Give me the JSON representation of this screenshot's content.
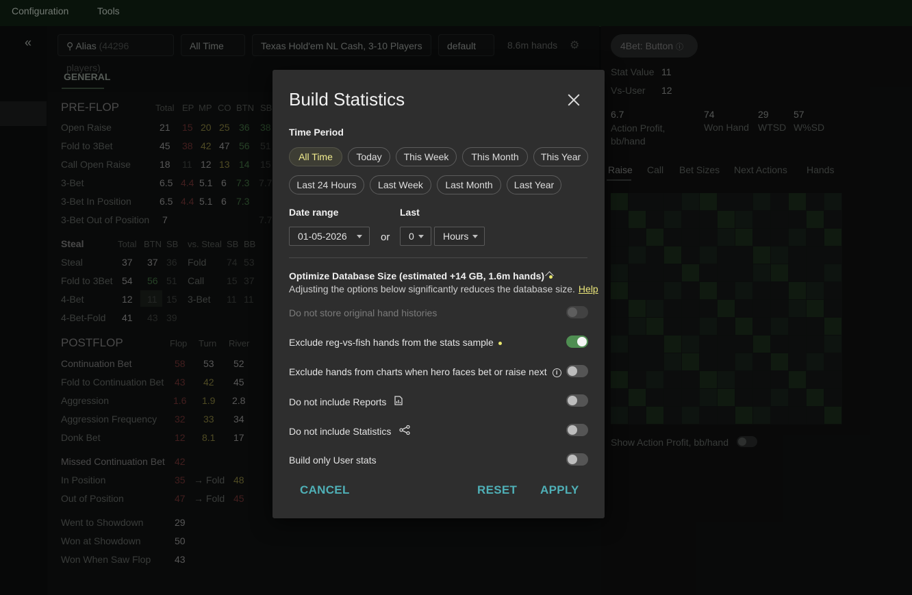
{
  "menubar": {
    "configuration": "Configuration",
    "tools": "Tools"
  },
  "filters": {
    "alias_label": "Alias",
    "alias_count": "(44296 players)",
    "period": "All Time",
    "game": "Texas Hold'em NL Cash, 3-10 Players",
    "preset": "default",
    "hands": "8.6m hands"
  },
  "tabs": {
    "general": "GENERAL"
  },
  "preflop": {
    "title": "PRE-FLOP",
    "cols": [
      "Total",
      "EP",
      "MP",
      "CO",
      "BTN",
      "SB"
    ],
    "rows": [
      {
        "label": "Open Raise",
        "values": [
          "21",
          "15",
          "20",
          "25",
          "36",
          "38"
        ]
      },
      {
        "label": "Fold to 3Bet",
        "values": [
          "45",
          "38",
          "42",
          "47",
          "56",
          "51"
        ]
      },
      {
        "label": "Call Open Raise",
        "values": [
          "18",
          "11",
          "12",
          "13",
          "14",
          "15"
        ]
      },
      {
        "label": "3-Bet",
        "values": [
          "6.5",
          "4.4",
          "5.1",
          "6",
          "7.3",
          "7.7"
        ]
      },
      {
        "label": "3-Bet In Position",
        "values": [
          "6.5",
          "4.4",
          "5.1",
          "6",
          "7.3",
          ""
        ]
      },
      {
        "label": "3-Bet Out of Position",
        "values": [
          "7",
          "",
          "",
          "",
          "",
          "7.7"
        ]
      }
    ]
  },
  "steal": {
    "title": "Steal",
    "cols": [
      "Total",
      "BTN",
      "SB",
      "vs. Steal",
      "SB",
      "BB"
    ],
    "rows": [
      {
        "label": "Steal",
        "values": [
          "37",
          "37",
          "36",
          "Fold",
          "74",
          "53"
        ]
      },
      {
        "label": "Fold to 3Bet",
        "values": [
          "54",
          "56",
          "51",
          "Call",
          "15",
          "37"
        ]
      },
      {
        "label": "4-Bet",
        "values": [
          "12",
          "11",
          "15",
          "3-Bet",
          "11",
          "11"
        ]
      },
      {
        "label": "4-Bet-Fold",
        "values": [
          "41",
          "43",
          "39",
          "",
          "",
          ""
        ]
      }
    ]
  },
  "postflop": {
    "title": "POSTFLOP",
    "cols": [
      "Flop",
      "Turn",
      "River"
    ],
    "rows": [
      {
        "label": "Continuation Bet",
        "values": [
          "58",
          "53",
          "52"
        ]
      },
      {
        "label": "Fold to Continuation Bet",
        "values": [
          "43",
          "42",
          "45"
        ]
      },
      {
        "label": "Aggression",
        "values": [
          "1.6",
          "1.9",
          "2.8"
        ]
      },
      {
        "label": "Aggression Frequency",
        "values": [
          "32",
          "33",
          "34"
        ]
      },
      {
        "label": "Donk Bet",
        "values": [
          "12",
          "8.1",
          "17"
        ]
      }
    ],
    "missed_title": "Missed Continuation Bet",
    "missed_value": "42",
    "missed_rows": [
      {
        "label": "In Position",
        "v1": "35",
        "arrow": "→ Fold",
        "v2": "48"
      },
      {
        "label": "Out of Position",
        "v1": "47",
        "arrow": "→ Fold",
        "v2": "45"
      }
    ],
    "showdown_rows": [
      {
        "label": "Went to Showdown",
        "value": "29"
      },
      {
        "label": "Won at Showdown",
        "value": "50"
      },
      {
        "label": "Won When Saw Flop",
        "value": "43"
      }
    ]
  },
  "right_panel": {
    "chip": "4Bet: Button",
    "stat_value_label": "Stat Value",
    "stat_value": "11",
    "vs_user_label": "Vs-User",
    "vs_user": "12",
    "metrics": [
      {
        "value": "6.7",
        "label": "Action Profit, bb/hand"
      },
      {
        "value": "74",
        "label": "Won Hand"
      },
      {
        "value": "29",
        "label": "WTSD"
      },
      {
        "value": "57",
        "label": "W%SD"
      }
    ],
    "tabs": [
      "Raise",
      "Call",
      "Bet Sizes",
      "Next Actions",
      "Hands"
    ],
    "show_profit_label": "Show Action Profit, bb/hand"
  },
  "modal": {
    "title": "Build Statistics",
    "time_period_label": "Time Period",
    "periods": [
      "All Time",
      "Today",
      "This Week",
      "This Month",
      "This Year",
      "Last 24 Hours",
      "Last Week",
      "Last Month",
      "Last Year"
    ],
    "selected_period": "All Time",
    "date_range_label": "Date range",
    "date_value": "01-05-2026",
    "or_label": "or",
    "last_label": "Last",
    "last_value": "0",
    "unit_value": "Hours",
    "optimize_title": "Optimize Database Size (estimated +14 GB, 1.6m hands)",
    "optimize_desc": "Adjusting the options below significantly reduces the database size.",
    "help_link": "Help",
    "options": [
      {
        "label": "Do not store original hand histories",
        "state": "disabled"
      },
      {
        "label": "Exclude reg-vs-fish hands from the stats sample",
        "state": "on"
      },
      {
        "label": "Exclude hands from charts when hero faces bet or raise next",
        "state": "off"
      },
      {
        "label": "Do not include Reports",
        "state": "off"
      },
      {
        "label": "Do not include Statistics",
        "state": "off"
      },
      {
        "label": "Build only User stats",
        "state": "off"
      }
    ],
    "cancel": "CANCEL",
    "reset": "RESET",
    "apply": "APPLY"
  },
  "colors": {
    "accent_teal": "#4fb0b7",
    "selected_yellow": "#f1ec8e",
    "toggle_on": "#4f8e52"
  }
}
